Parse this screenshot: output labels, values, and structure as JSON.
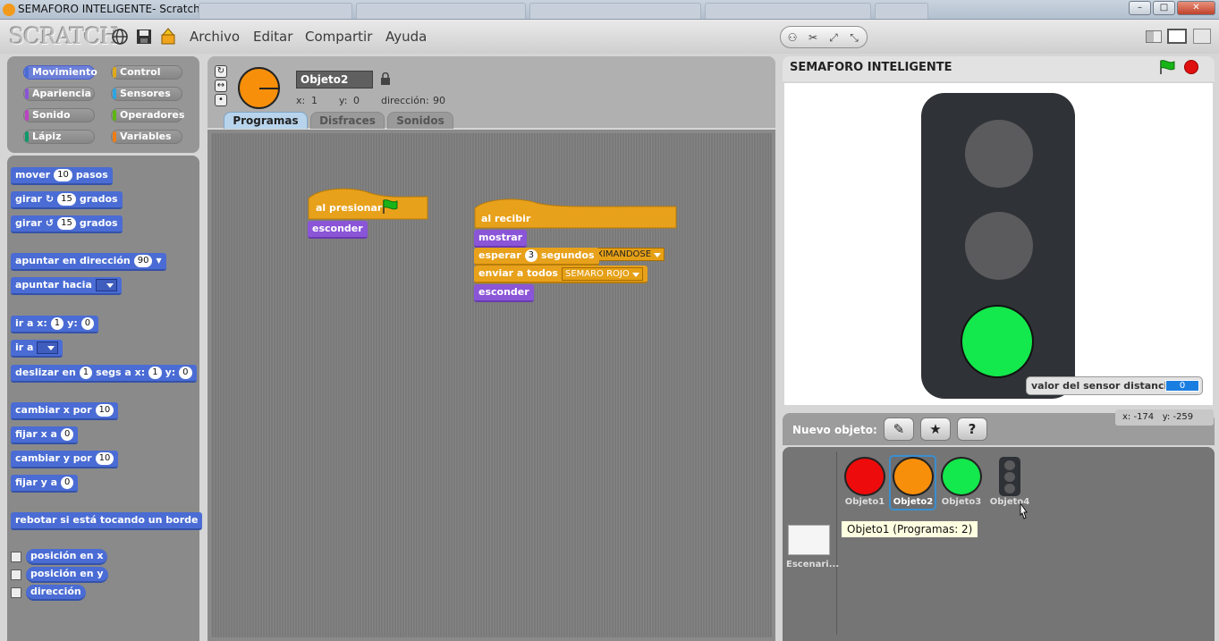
{
  "window": {
    "title": "SEMAFORO INTELIGENTE- Scratch"
  },
  "menu": {
    "items": [
      "Archivo",
      "Editar",
      "Compartir",
      "Ayuda"
    ]
  },
  "categories": [
    {
      "label": "Movimiento",
      "color": "#4a6cd4",
      "selected": true
    },
    {
      "label": "Control",
      "color": "#e1a91a",
      "selected": false
    },
    {
      "label": "Apariencia",
      "color": "#8a55d7",
      "selected": false
    },
    {
      "label": "Sensores",
      "color": "#2ca5e2",
      "selected": false
    },
    {
      "label": "Sonido",
      "color": "#bb42c3",
      "selected": false
    },
    {
      "label": "Operadores",
      "color": "#5cb712",
      "selected": false
    },
    {
      "label": "Lápiz",
      "color": "#0e9a6c",
      "selected": false
    },
    {
      "label": "Variables",
      "color": "#ee7d16",
      "selected": false
    }
  ],
  "palette": {
    "mover": [
      "mover",
      "10",
      "pasos"
    ],
    "girar_der": [
      "girar",
      "15",
      "grados"
    ],
    "girar_izq": [
      "girar",
      "15",
      "grados"
    ],
    "apuntar_dir": [
      "apuntar en dirección",
      "90"
    ],
    "apuntar_hacia": "apuntar hacia",
    "ir_a_xy": [
      "ir a x:",
      "1",
      "y:",
      "0"
    ],
    "ir_a": "ir a",
    "deslizar": [
      "deslizar en",
      "1",
      "segs a x:",
      "1",
      "y:",
      "0"
    ],
    "cambiar_x": [
      "cambiar x por",
      "10"
    ],
    "fijar_x": [
      "fijar x a",
      "0"
    ],
    "cambiar_y": [
      "cambiar y por",
      "10"
    ],
    "fijar_y": [
      "fijar y a",
      "0"
    ],
    "rebotar": "rebotar si está tocando un borde",
    "reporters": [
      "posición en x",
      "posición en y",
      "dirección"
    ]
  },
  "sprite": {
    "name": "Objeto2",
    "x_label": "x:",
    "x": "1",
    "y_label": "y:",
    "y": "0",
    "dir_label": "dirección:",
    "dir": "90"
  },
  "tabs": [
    "Programas",
    "Disfraces",
    "Sonidos"
  ],
  "scripts": {
    "s1": {
      "hat": "al presionar",
      "body": [
        "esconder"
      ]
    },
    "s2": {
      "hat": "al recibir",
      "hat_value": "PEATON APROXIMANDOSE",
      "mostrar": "mostrar",
      "esperar": [
        "esperar",
        "3",
        "segundos"
      ],
      "enviar": [
        "enviar a todos",
        "SEMARO ROJO"
      ],
      "esconder": "esconder"
    }
  },
  "stage": {
    "title": "SEMAFORO INTELIGENTE",
    "monitor_label": "valor del sensor distancia",
    "monitor_value": "0",
    "coords_x": "x: -174",
    "coords_y": "y: -259"
  },
  "sprites_panel": {
    "new_label": "Nuevo objeto:",
    "items": [
      {
        "name": "Objeto1",
        "color": "#ee0b0b"
      },
      {
        "name": "Objeto2",
        "color": "#f78f0a"
      },
      {
        "name": "Objeto3",
        "color": "#13e84c"
      },
      {
        "name": "Objeto4",
        "color": "#2e3136"
      }
    ],
    "stage_label": "Escenari...",
    "tooltip": "Objeto1 (Programas: 2)"
  }
}
